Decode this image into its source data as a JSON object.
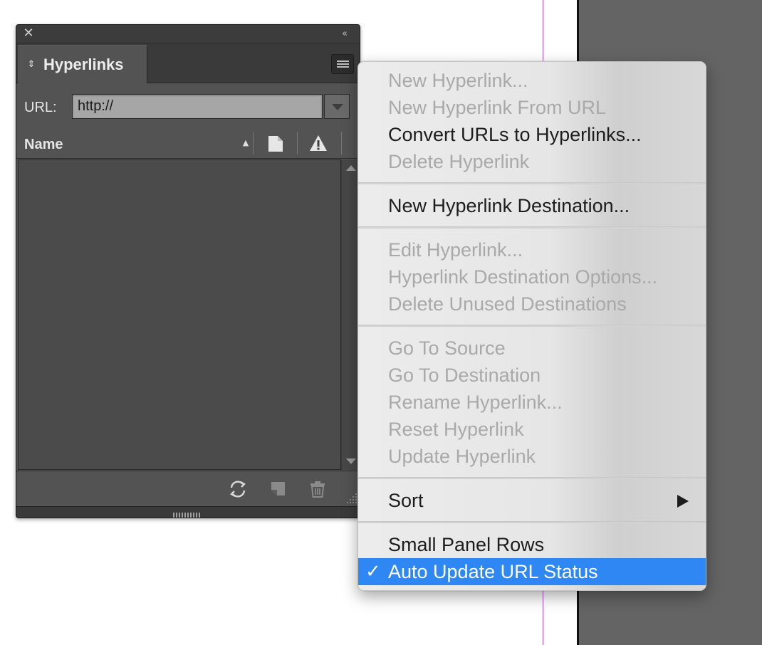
{
  "panel": {
    "close_glyph": "✕",
    "collapse_glyph": "«",
    "tab_label": "Hyperlinks",
    "tab_arrows_glyph": "⇕",
    "url_label": "URL:",
    "url_value": "http://",
    "col_name": "Name",
    "sort_arrow_glyph": "▲",
    "icons": {
      "close": "close-icon",
      "collapse": "double-chevron-left-icon",
      "tab_arrows": "expand-collapse-icon",
      "panel_menu": "hamburger-menu-icon",
      "page": "page-icon",
      "status": "warning-icon",
      "refresh": "refresh-icon",
      "new": "new-hyperlink-icon",
      "delete": "trash-icon"
    }
  },
  "menu": {
    "items": [
      {
        "label": "New Hyperlink...",
        "state": "disabled"
      },
      {
        "label": "New Hyperlink From URL",
        "state": "disabled"
      },
      {
        "label": "Convert URLs to Hyperlinks...",
        "state": "enabled"
      },
      {
        "label": "Delete Hyperlink",
        "state": "disabled"
      },
      {
        "label": "New Hyperlink Destination...",
        "state": "enabled"
      },
      {
        "label": "Edit Hyperlink...",
        "state": "disabled"
      },
      {
        "label": "Hyperlink Destination Options...",
        "state": "disabled"
      },
      {
        "label": "Delete Unused Destinations",
        "state": "disabled"
      },
      {
        "label": "Go To Source",
        "state": "disabled"
      },
      {
        "label": "Go To Destination",
        "state": "disabled"
      },
      {
        "label": "Rename Hyperlink...",
        "state": "disabled"
      },
      {
        "label": "Reset Hyperlink",
        "state": "disabled"
      },
      {
        "label": "Update Hyperlink",
        "state": "disabled"
      },
      {
        "label": "Sort",
        "state": "enabled"
      },
      {
        "label": "Small Panel Rows",
        "state": "enabled"
      },
      {
        "label": "Auto Update URL Status",
        "state": "selected"
      }
    ],
    "check_glyph": "✓",
    "selected_color": "#2f87f3"
  }
}
